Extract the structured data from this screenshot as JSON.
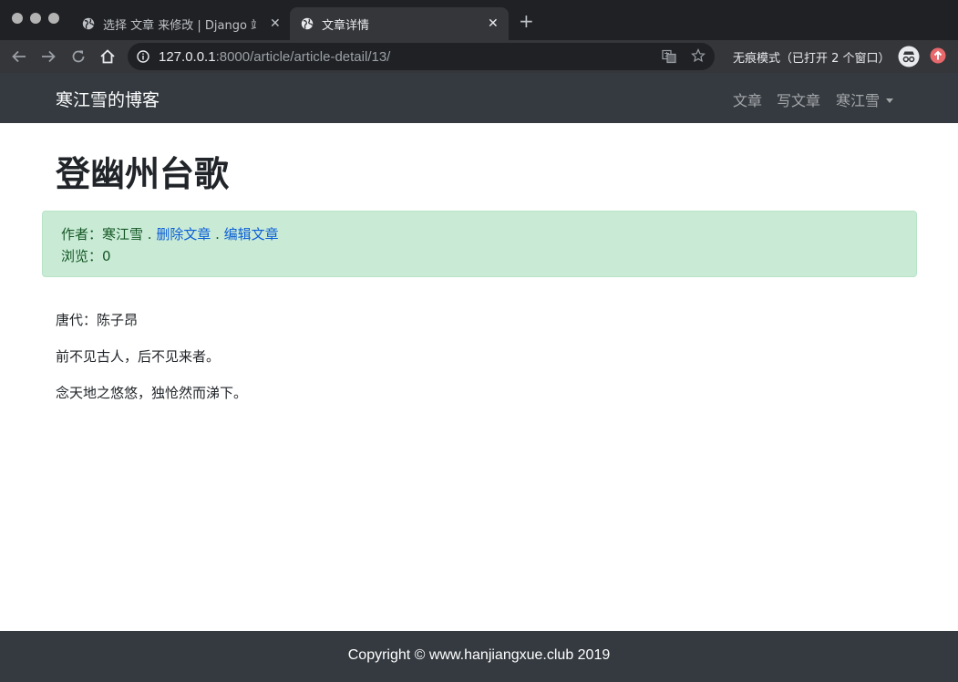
{
  "browser": {
    "tabs": [
      {
        "title": "选择 文章 来修改 | Django 站点管",
        "close": "✕",
        "active": false
      },
      {
        "title": "文章详情",
        "close": "✕",
        "active": true
      }
    ],
    "new_tab": "+",
    "url": {
      "host": "127.0.0.1",
      "rest": ":8000/article/article-detail/13/"
    },
    "incognito_label": "无痕模式（已打开 2 个窗口）",
    "colors": {
      "tabbar": "#202124",
      "toolbar": "#35363a",
      "update_badge": "#e9686b"
    }
  },
  "navbar": {
    "brand": "寒江雪的博客",
    "links": [
      "文章",
      "写文章"
    ],
    "user_menu": "寒江雪",
    "background": "#343a40"
  },
  "article": {
    "title": "登幽州台歌",
    "meta": {
      "author_label": "作者：",
      "author": "寒江雪",
      "sep1": " . ",
      "delete_link": "删除文章",
      "sep2": " . ",
      "edit_link": "编辑文章",
      "views_label": "浏览：",
      "views": "0",
      "alert_color": "#c9ebd6",
      "link_color": "#0b5ed7"
    },
    "body": [
      "唐代：陈子昂",
      "前不见古人，后不见来者。",
      "念天地之悠悠，独怆然而涕下。"
    ]
  },
  "footer": {
    "text": "Copyright © www.hanjiangxue.club 2019"
  }
}
